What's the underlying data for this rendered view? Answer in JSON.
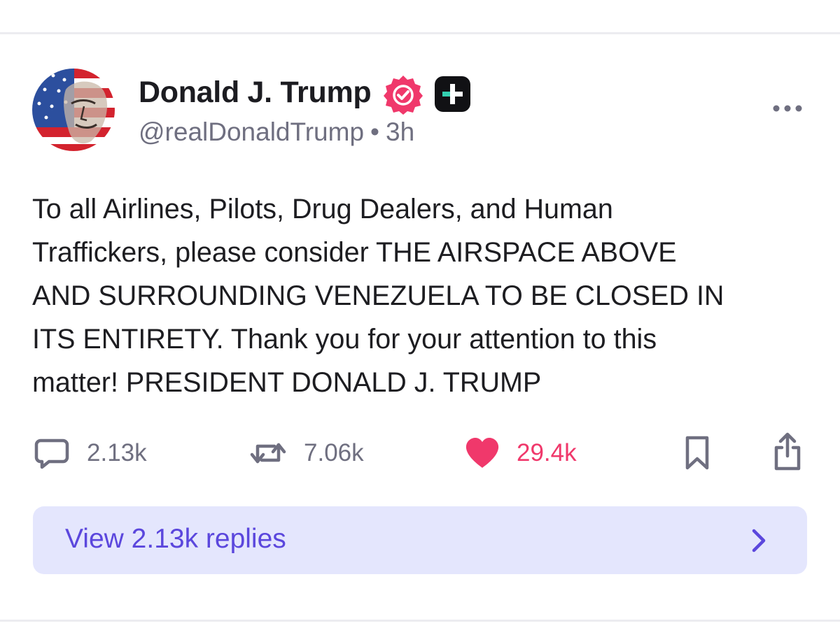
{
  "post": {
    "author": {
      "display_name": "Donald J. Trump",
      "handle": "@realDonaldTrump",
      "verified": true,
      "badge_icon": "plus-badge-icon"
    },
    "separator": "•",
    "timestamp": "3h",
    "text": "To all Airlines, Pilots, Drug Dealers, and Human Traffickers, please consider THE AIRSPACE ABOVE AND SURROUNDING VENEZUELA TO BE CLOSED IN ITS ENTIRETY. Thank you for your attention to this matter! PRESIDENT DONALD J. TRUMP",
    "text_lines": [
      "To all Airlines, Pilots, Drug Dealers, and Human",
      "Traffickers, please consider THE AIRSPACE ABOVE",
      "AND SURROUNDING VENEZUELA TO BE CLOSED IN",
      "ITS ENTIRETY. Thank you for your attention to this",
      "matter! PRESIDENT DONALD J. TRUMP"
    ],
    "actions": {
      "replies": "2.13k",
      "reposts": "7.06k",
      "likes": "29.4k",
      "liked": true
    },
    "view_replies_label": "View 2.13k replies"
  },
  "colors": {
    "accent": "#5b47dd",
    "like": "#f0386b",
    "verified": "#f0386b",
    "muted_text": "#6f6f80",
    "view_replies_bg": "#e4e6fd"
  }
}
